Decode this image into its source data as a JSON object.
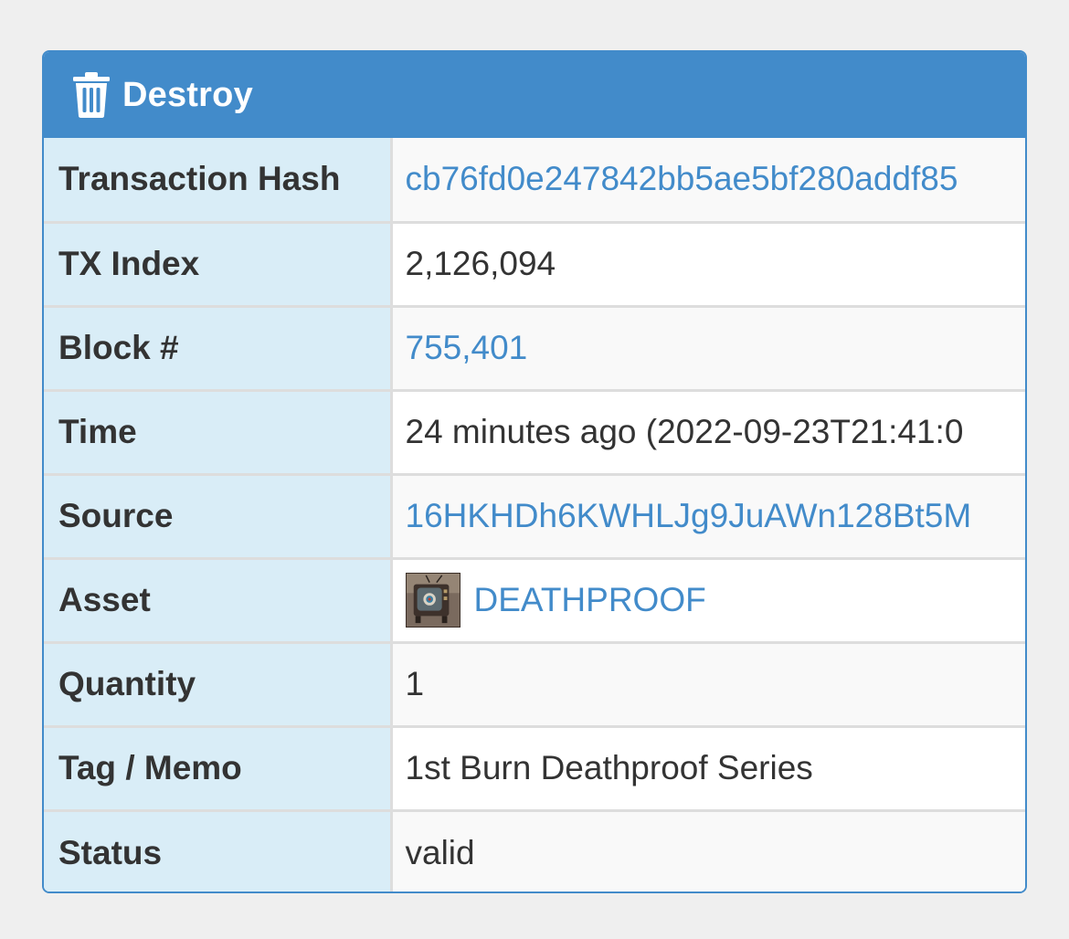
{
  "panel": {
    "title": "Destroy",
    "icon": "trash-icon",
    "accent": "#428bca"
  },
  "rows": {
    "tx_hash": {
      "label": "Transaction Hash",
      "value": "cb76fd0e247842bb5ae5bf280addf85"
    },
    "tx_index": {
      "label": "TX Index",
      "value": "2,126,094"
    },
    "block": {
      "label": "Block #",
      "value": "755,401"
    },
    "time": {
      "label": "Time",
      "value": "24 minutes ago (2022-09-23T21:41:0"
    },
    "source": {
      "label": "Source",
      "value": "16HKHDh6KWHLJg9JuAWn128Bt5M"
    },
    "asset": {
      "label": "Asset",
      "value": "DEATHPROOF",
      "icon": "asset-thumbnail"
    },
    "quantity": {
      "label": "Quantity",
      "value": "1"
    },
    "memo": {
      "label": "Tag / Memo",
      "value": "1st Burn Deathproof Series"
    },
    "status": {
      "label": "Status",
      "value": "valid"
    }
  }
}
